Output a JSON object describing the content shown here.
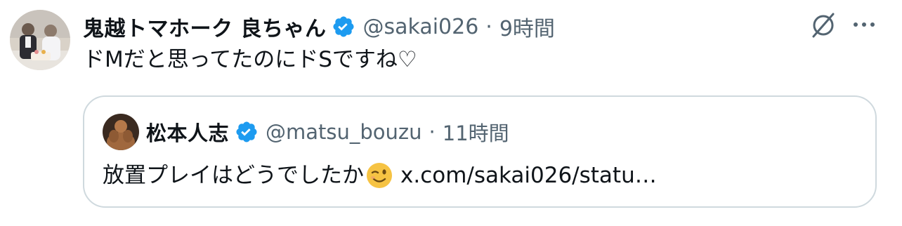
{
  "tweet": {
    "author": {
      "display_name": "鬼越トマホーク 良ちゃん",
      "handle": "@sakai026",
      "time": "9時間",
      "separator": "·",
      "verified_icon": "verified-badge-icon"
    },
    "text": "ドMだと思ってたのにドSですね♡",
    "actions": {
      "grok_icon": "grok-icon",
      "more_icon": "more-options-icon"
    }
  },
  "quoted_tweet": {
    "author": {
      "display_name": "松本人志",
      "handle": "@matsu_bouzu",
      "time": "11時間",
      "separator": "·",
      "verified_icon": "verified-badge-icon"
    },
    "text": "放置プレイはどうでしたか",
    "emoji": "winking-face-emoji",
    "link": "x.com/sakai026/statu…"
  },
  "colors": {
    "text_primary": "#0f1419",
    "text_secondary": "#536471",
    "verified_blue": "#1d9bf0",
    "border": "#cfd9de"
  }
}
